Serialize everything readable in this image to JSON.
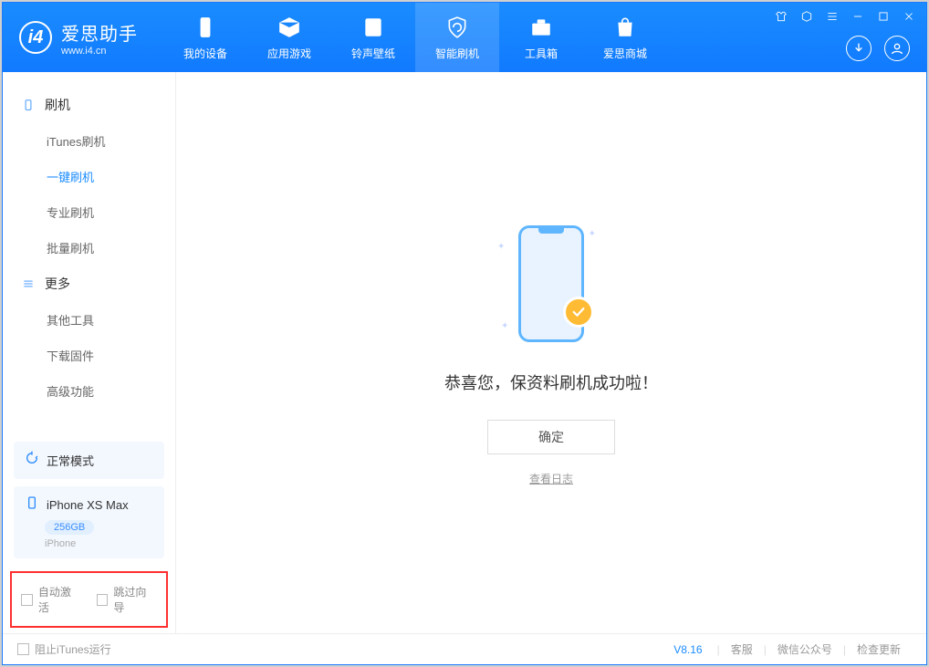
{
  "logo": {
    "cn": "爱思助手",
    "en": "www.i4.cn",
    "glyph": "i4"
  },
  "tabs": [
    {
      "label": "我的设备"
    },
    {
      "label": "应用游戏"
    },
    {
      "label": "铃声壁纸"
    },
    {
      "label": "智能刷机"
    },
    {
      "label": "工具箱"
    },
    {
      "label": "爱思商城"
    }
  ],
  "sidebar": {
    "section1_title": "刷机",
    "items1": [
      {
        "label": "iTunes刷机"
      },
      {
        "label": "一键刷机"
      },
      {
        "label": "专业刷机"
      },
      {
        "label": "批量刷机"
      }
    ],
    "section2_title": "更多",
    "items2": [
      {
        "label": "其他工具"
      },
      {
        "label": "下载固件"
      },
      {
        "label": "高级功能"
      }
    ]
  },
  "device": {
    "mode": "正常模式",
    "name": "iPhone XS Max",
    "storage": "256GB",
    "type": "iPhone"
  },
  "options": {
    "auto_activate": "自动激活",
    "skip_guide": "跳过向导"
  },
  "main": {
    "success_text": "恭喜您，保资料刷机成功啦！",
    "ok_button": "确定",
    "view_log": "查看日志"
  },
  "footer": {
    "block_itunes": "阻止iTunes运行",
    "version": "V8.16",
    "links": [
      "客服",
      "微信公众号",
      "检查更新"
    ]
  }
}
